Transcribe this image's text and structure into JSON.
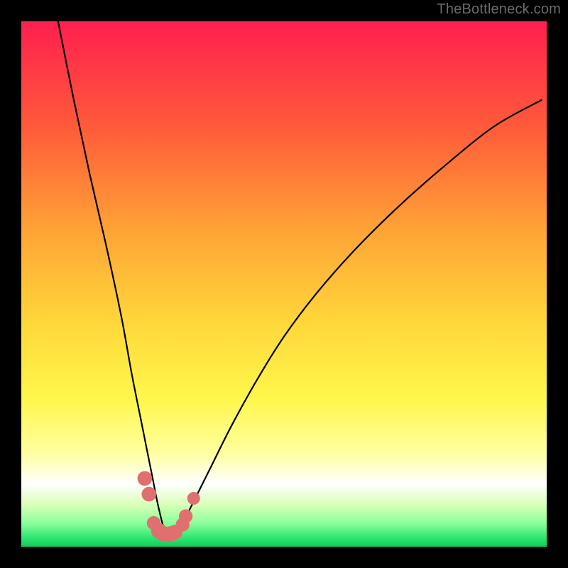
{
  "watermark": "TheBottleneck.com",
  "colors": {
    "page_bg": "#000000",
    "watermark": "#6b6b6b",
    "curve": "#000000",
    "marker": "#e06f6f",
    "gradient_stops": [
      {
        "offset": 0.0,
        "color": "#ff1f4f"
      },
      {
        "offset": 0.2,
        "color": "#ff5a3a"
      },
      {
        "offset": 0.4,
        "color": "#ffa436"
      },
      {
        "offset": 0.58,
        "color": "#ffd93a"
      },
      {
        "offset": 0.72,
        "color": "#fff74d"
      },
      {
        "offset": 0.82,
        "color": "#ffff9e"
      },
      {
        "offset": 0.88,
        "color": "#ffffff"
      },
      {
        "offset": 0.92,
        "color": "#d9ffb8"
      },
      {
        "offset": 0.955,
        "color": "#8cff9a"
      },
      {
        "offset": 0.985,
        "color": "#27e56f"
      },
      {
        "offset": 1.0,
        "color": "#14c95c"
      }
    ]
  },
  "chart_data": {
    "type": "line",
    "title": "",
    "xlabel": "",
    "ylabel": "",
    "xlim": [
      0,
      100
    ],
    "ylim": [
      0,
      100
    ],
    "grid": false,
    "legend": false,
    "notes": "Bottleneck-style V-curve. Y reads as percent (100 top, 0 at bottom band). Minimum around x≈27. Values estimated from pixels.",
    "series": [
      {
        "name": "curve",
        "x": [
          7,
          10,
          13,
          16,
          19,
          21,
          23,
          25,
          26,
          27,
          28,
          29,
          30,
          31,
          33,
          36,
          40,
          45,
          50,
          56,
          63,
          71,
          80,
          90,
          99
        ],
        "values": [
          100,
          85,
          71,
          58,
          44,
          33,
          23,
          13,
          8,
          4,
          2,
          2,
          3,
          5,
          9,
          15,
          23,
          32,
          40,
          48,
          56,
          64,
          72,
          80,
          85
        ]
      }
    ],
    "markers": [
      {
        "x": 23.5,
        "y": 13,
        "r": 1.1
      },
      {
        "x": 24.3,
        "y": 10,
        "r": 1.1
      },
      {
        "x": 25.2,
        "y": 4.5,
        "r": 1.0
      },
      {
        "x": 26.2,
        "y": 3.0,
        "r": 1.2
      },
      {
        "x": 27.2,
        "y": 2.4,
        "r": 1.2
      },
      {
        "x": 28.3,
        "y": 2.4,
        "r": 1.2
      },
      {
        "x": 29.3,
        "y": 2.8,
        "r": 1.1
      },
      {
        "x": 30.7,
        "y": 4.2,
        "r": 1.0
      },
      {
        "x": 31.3,
        "y": 5.8,
        "r": 1.0
      },
      {
        "x": 32.8,
        "y": 9.2,
        "r": 0.9
      }
    ]
  }
}
